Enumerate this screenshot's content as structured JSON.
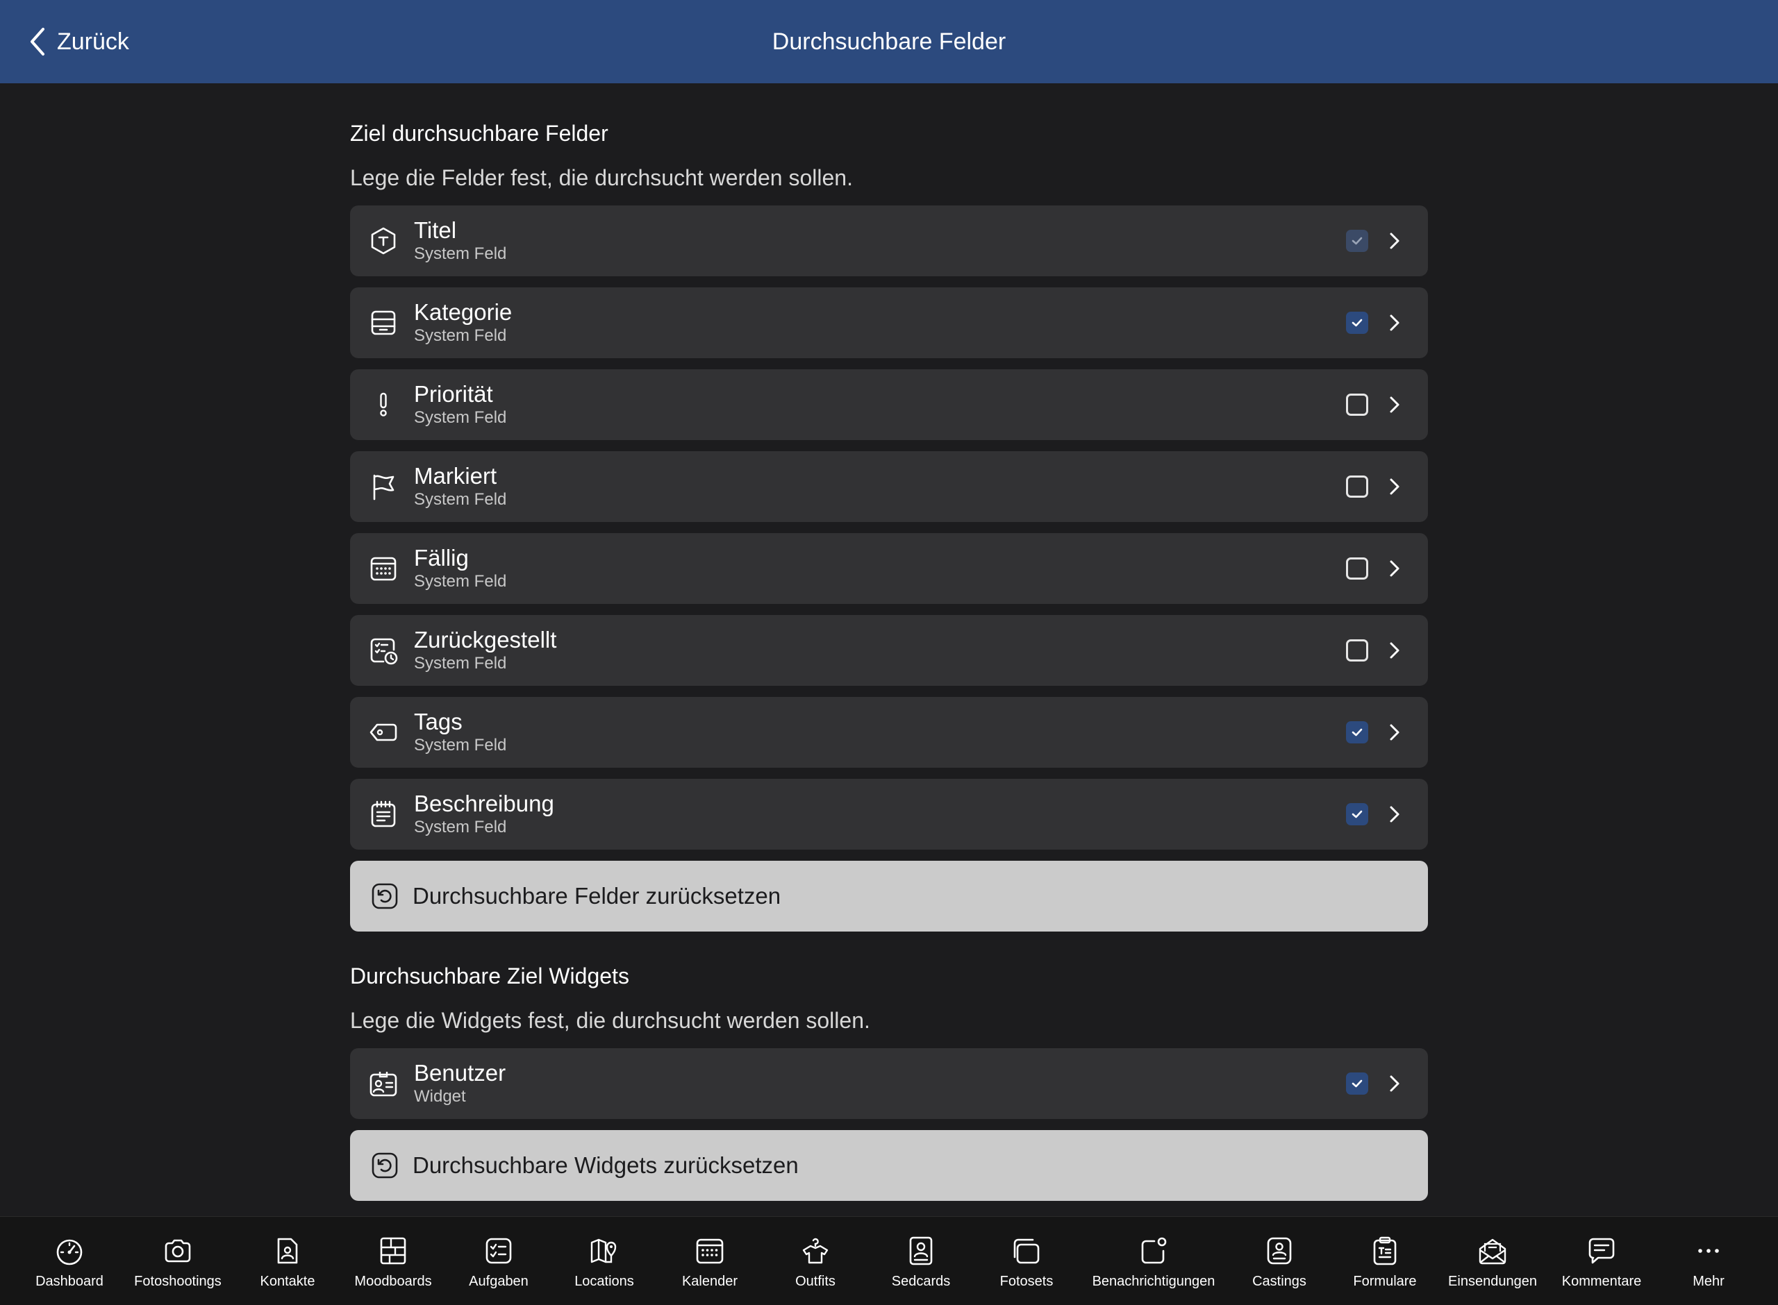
{
  "header": {
    "back_label": "Zurück",
    "title": "Durchsuchbare Felder"
  },
  "colors": {
    "header_bg": "#2c4a7e",
    "background": "#1c1c1e",
    "row_bg": "#323234",
    "accent": "#2c4a7e",
    "reset_bg": "#cbcbcb"
  },
  "fields_section": {
    "title": "Ziel durchsuchbare Felder",
    "description": "Lege die Felder fest, die durchsucht werden sollen.",
    "items": [
      {
        "label": "Titel",
        "sub": "System Feld",
        "icon": "title-hexagon-icon",
        "checked": true,
        "disabled": true
      },
      {
        "label": "Kategorie",
        "sub": "System Feld",
        "icon": "category-tray-icon",
        "checked": true
      },
      {
        "label": "Priorität",
        "sub": "System Feld",
        "icon": "exclamation-icon",
        "checked": false
      },
      {
        "label": "Markiert",
        "sub": "System Feld",
        "icon": "flag-icon",
        "checked": false
      },
      {
        "label": "Fällig",
        "sub": "System Feld",
        "icon": "calendar-icon",
        "checked": false
      },
      {
        "label": "Zurückgestellt",
        "sub": "System Feld",
        "icon": "deferred-list-clock-icon",
        "checked": false
      },
      {
        "label": "Tags",
        "sub": "System Feld",
        "icon": "tag-icon",
        "checked": true
      },
      {
        "label": "Beschreibung",
        "sub": "System Feld",
        "icon": "notepad-icon",
        "checked": true
      }
    ],
    "reset_label": "Durchsuchbare Felder zurücksetzen"
  },
  "widgets_section": {
    "title": "Durchsuchbare Ziel Widgets",
    "description": "Lege die Widgets fest, die durchsucht werden sollen.",
    "items": [
      {
        "label": "Benutzer",
        "sub": "Widget",
        "icon": "user-card-icon",
        "checked": true
      }
    ],
    "reset_label": "Durchsuchbare Widgets zurücksetzen"
  },
  "tabbar": {
    "items": [
      {
        "label": "Dashboard",
        "icon": "speedometer-icon"
      },
      {
        "label": "Fotoshootings",
        "icon": "camera-icon"
      },
      {
        "label": "Kontakte",
        "icon": "contact-file-icon"
      },
      {
        "label": "Moodboards",
        "icon": "moodboard-grid-icon"
      },
      {
        "label": "Aufgaben",
        "icon": "task-list-icon"
      },
      {
        "label": "Locations",
        "icon": "map-pin-icon"
      },
      {
        "label": "Kalender",
        "icon": "calendar-icon"
      },
      {
        "label": "Outfits",
        "icon": "shirt-hanger-icon"
      },
      {
        "label": "Sedcards",
        "icon": "sedcard-portrait-icon"
      },
      {
        "label": "Fotosets",
        "icon": "photo-stack-icon"
      },
      {
        "label": "Benachrichtigungen",
        "icon": "notification-badge-icon"
      },
      {
        "label": "Castings",
        "icon": "casting-badge-icon"
      },
      {
        "label": "Formulare",
        "icon": "clipboard-form-icon"
      },
      {
        "label": "Einsendungen",
        "icon": "envelope-open-icon"
      },
      {
        "label": "Kommentare",
        "icon": "comment-bubble-icon"
      },
      {
        "label": "Mehr",
        "icon": "more-dots-icon"
      }
    ]
  }
}
